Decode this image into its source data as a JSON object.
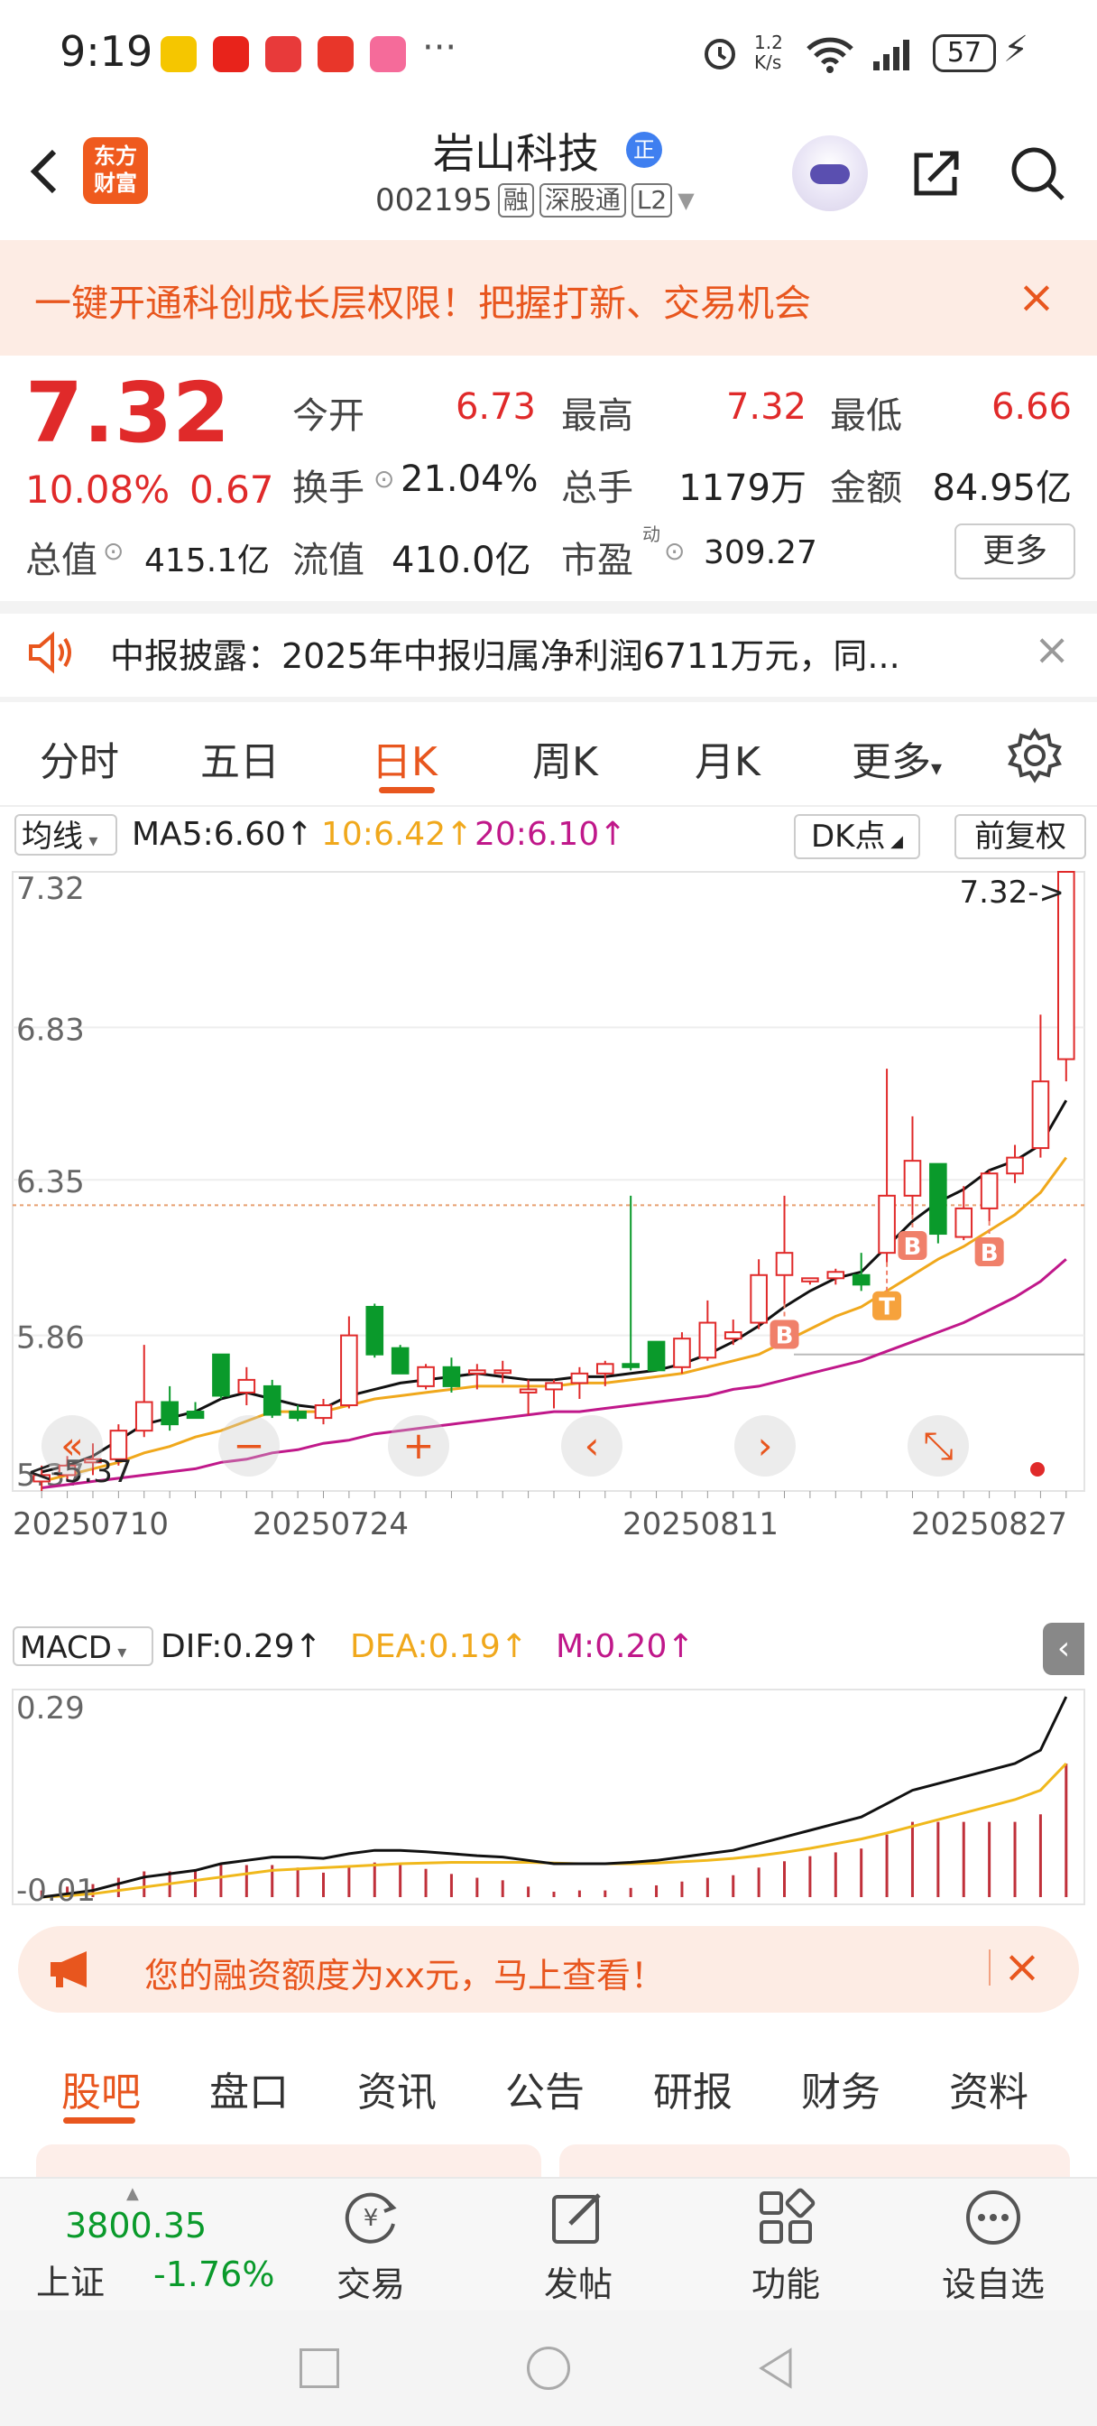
{
  "status_bar": {
    "time": "9:19",
    "dots": "···",
    "speed": "1.2\nK/s",
    "battery": "57"
  },
  "header": {
    "logo_line1": "东方",
    "logo_line2": "财富",
    "stock_name": "岩山科技",
    "name_badge": "正",
    "code": "002195",
    "tags": [
      "融",
      "深股通",
      "L2"
    ]
  },
  "banner": {
    "text": "一键开通科创成长层权限！把握打新、交易机会",
    "close": "×"
  },
  "quote": {
    "price": "7.32",
    "pct": "10.08%",
    "change": "0.67",
    "fields": [
      {
        "label": "今开",
        "value": "6.73",
        "color": "#e02a2a"
      },
      {
        "label": "最高",
        "value": "7.32",
        "color": "#e02a2a"
      },
      {
        "label": "最低",
        "value": "6.66",
        "color": "#e02a2a"
      },
      {
        "label": "换手",
        "value": "21.04%",
        "color": "#222"
      },
      {
        "label": "总手",
        "value": "1179万",
        "color": "#222"
      },
      {
        "label": "金额",
        "value": "84.95亿",
        "color": "#222"
      },
      {
        "label": "总值",
        "value": "415.1亿",
        "color": "#222"
      },
      {
        "label": "流值",
        "value": "410.0亿",
        "color": "#222"
      },
      {
        "label": "市盈",
        "value": "309.27",
        "color": "#222"
      }
    ],
    "pe_superscript": "动",
    "more": "更多"
  },
  "announcement": {
    "text": "中报披露：2025年中报归属净利润6711万元，同...",
    "close": "×"
  },
  "kline_tabs": [
    "分时",
    "五日",
    "日K",
    "周K",
    "月K",
    "更多"
  ],
  "active_tab": "日K",
  "ma_row": {
    "selector": "均线",
    "ma5": "MA5:6.60↑",
    "ma10": "10:6.42↑",
    "ma20": "20:6.10↑",
    "dk": "DK点",
    "fq": "前复权"
  },
  "chart_data": {
    "type": "candlestick",
    "y_ticks": [
      "7.32",
      "6.83",
      "6.35",
      "5.86",
      "5.37"
    ],
    "ylim": [
      5.37,
      7.32
    ],
    "x_ticks": [
      "20250710",
      "20250724",
      "20250811",
      "20250827"
    ],
    "last_price_label": "7.32->",
    "low_label": "<-5.37",
    "candles": [
      {
        "o": 5.4,
        "h": 5.45,
        "l": 5.37,
        "c": 5.42
      },
      {
        "o": 5.42,
        "h": 5.48,
        "l": 5.4,
        "c": 5.45
      },
      {
        "o": 5.46,
        "h": 5.52,
        "l": 5.42,
        "c": 5.47
      },
      {
        "o": 5.47,
        "h": 5.58,
        "l": 5.45,
        "c": 5.56
      },
      {
        "o": 5.56,
        "h": 5.83,
        "l": 5.54,
        "c": 5.65
      },
      {
        "o": 5.65,
        "h": 5.7,
        "l": 5.56,
        "c": 5.58
      },
      {
        "o": 5.62,
        "h": 5.65,
        "l": 5.72,
        "c": 5.6
      },
      {
        "o": 5.8,
        "h": 5.8,
        "l": 5.66,
        "c": 5.67
      },
      {
        "o": 5.68,
        "h": 5.76,
        "l": 5.64,
        "c": 5.72
      },
      {
        "o": 5.7,
        "h": 5.72,
        "l": 5.6,
        "c": 5.61
      },
      {
        "o": 5.62,
        "h": 5.64,
        "l": 5.59,
        "c": 5.6
      },
      {
        "o": 5.6,
        "h": 5.66,
        "l": 5.58,
        "c": 5.64
      },
      {
        "o": 5.64,
        "h": 5.92,
        "l": 5.63,
        "c": 5.86
      },
      {
        "o": 5.95,
        "h": 5.96,
        "l": 5.79,
        "c": 5.8
      },
      {
        "o": 5.82,
        "h": 5.83,
        "l": 5.74,
        "c": 5.74
      },
      {
        "o": 5.7,
        "h": 5.77,
        "l": 5.69,
        "c": 5.76
      },
      {
        "o": 5.76,
        "h": 5.79,
        "l": 5.68,
        "c": 5.7
      },
      {
        "o": 5.74,
        "h": 5.77,
        "l": 5.69,
        "c": 5.75
      },
      {
        "o": 5.75,
        "h": 5.78,
        "l": 5.71,
        "c": 5.75
      },
      {
        "o": 5.68,
        "h": 5.72,
        "l": 5.61,
        "c": 5.69
      },
      {
        "o": 5.69,
        "h": 5.72,
        "l": 5.63,
        "c": 5.71
      },
      {
        "o": 5.71,
        "h": 5.76,
        "l": 5.66,
        "c": 5.74
      },
      {
        "o": 5.74,
        "h": 5.78,
        "l": 5.7,
        "c": 5.77
      },
      {
        "o": 5.77,
        "h": 6.3,
        "l": 5.75,
        "c": 5.76
      },
      {
        "o": 5.84,
        "h": 5.84,
        "l": 5.75,
        "c": 5.75
      },
      {
        "o": 5.76,
        "h": 5.87,
        "l": 5.74,
        "c": 5.85
      },
      {
        "o": 5.79,
        "h": 5.97,
        "l": 5.78,
        "c": 5.9
      },
      {
        "o": 5.85,
        "h": 5.91,
        "l": 5.83,
        "c": 5.87
      },
      {
        "o": 5.9,
        "h": 6.1,
        "l": 5.88,
        "c": 6.05
      },
      {
        "o": 6.05,
        "h": 6.3,
        "l": 5.96,
        "c": 6.12
      },
      {
        "o": 6.03,
        "h": 6.04,
        "l": 6.02,
        "c": 6.04
      },
      {
        "o": 6.04,
        "h": 6.07,
        "l": 6.02,
        "c": 6.06
      },
      {
        "o": 6.05,
        "h": 6.12,
        "l": 6.0,
        "c": 6.02
      },
      {
        "o": 6.12,
        "h": 6.7,
        "l": 6.09,
        "c": 6.3
      },
      {
        "o": 6.3,
        "h": 6.55,
        "l": 6.24,
        "c": 6.41
      },
      {
        "o": 6.4,
        "h": 6.4,
        "l": 6.15,
        "c": 6.18
      },
      {
        "o": 6.17,
        "h": 6.33,
        "l": 6.16,
        "c": 6.26
      },
      {
        "o": 6.26,
        "h": 6.38,
        "l": 6.22,
        "c": 6.37
      },
      {
        "o": 6.37,
        "h": 6.46,
        "l": 6.34,
        "c": 6.42
      },
      {
        "o": 6.45,
        "h": 6.87,
        "l": 6.42,
        "c": 6.66
      },
      {
        "o": 6.73,
        "h": 7.32,
        "l": 6.66,
        "c": 7.32
      }
    ],
    "ma5": [
      5.43,
      5.45,
      5.48,
      5.53,
      5.58,
      5.6,
      5.62,
      5.66,
      5.68,
      5.66,
      5.64,
      5.63,
      5.67,
      5.69,
      5.71,
      5.72,
      5.73,
      5.74,
      5.73,
      5.72,
      5.72,
      5.73,
      5.73,
      5.74,
      5.75,
      5.77,
      5.8,
      5.84,
      5.89,
      5.95,
      6.0,
      6.04,
      6.06,
      6.14,
      6.22,
      6.28,
      6.32,
      6.38,
      6.41,
      6.46,
      6.6
    ],
    "ma10": [
      5.4,
      5.42,
      5.44,
      5.46,
      5.49,
      5.51,
      5.54,
      5.56,
      5.59,
      5.62,
      5.62,
      5.62,
      5.64,
      5.66,
      5.67,
      5.68,
      5.69,
      5.7,
      5.7,
      5.7,
      5.7,
      5.71,
      5.71,
      5.72,
      5.73,
      5.74,
      5.76,
      5.78,
      5.8,
      5.84,
      5.88,
      5.92,
      5.95,
      6.0,
      6.05,
      6.1,
      6.14,
      6.19,
      6.24,
      6.31,
      6.42
    ],
    "ma20": [
      5.38,
      5.39,
      5.4,
      5.41,
      5.42,
      5.43,
      5.44,
      5.46,
      5.47,
      5.49,
      5.5,
      5.52,
      5.53,
      5.55,
      5.56,
      5.57,
      5.58,
      5.59,
      5.6,
      5.61,
      5.62,
      5.62,
      5.63,
      5.64,
      5.65,
      5.66,
      5.67,
      5.69,
      5.7,
      5.72,
      5.74,
      5.76,
      5.78,
      5.81,
      5.84,
      5.87,
      5.9,
      5.94,
      5.98,
      6.03,
      6.1
    ],
    "markers": [
      {
        "label": "B",
        "index": 29,
        "type": "buy"
      },
      {
        "label": "T",
        "index": 33,
        "type": "t"
      },
      {
        "label": "B",
        "index": 34,
        "type": "buy"
      },
      {
        "label": "B",
        "index": 37,
        "type": "buy"
      }
    ],
    "macd": {
      "selector": "MACD",
      "dif_label": "DIF:0.29↑",
      "dea_label": "DEA:0.19↑",
      "m_label": "M:0.20↑",
      "y_ticks": [
        "0.29",
        "-0.01"
      ],
      "ylim": [
        -0.01,
        0.29
      ],
      "dif": [
        -0.01,
        -0.005,
        0.0,
        0.01,
        0.02,
        0.025,
        0.03,
        0.04,
        0.045,
        0.05,
        0.05,
        0.048,
        0.055,
        0.06,
        0.06,
        0.058,
        0.055,
        0.052,
        0.05,
        0.045,
        0.04,
        0.04,
        0.04,
        0.042,
        0.045,
        0.05,
        0.055,
        0.06,
        0.07,
        0.08,
        0.09,
        0.1,
        0.11,
        0.13,
        0.15,
        0.16,
        0.17,
        0.18,
        0.19,
        0.21,
        0.29
      ],
      "dea": [
        -0.01,
        -0.008,
        -0.005,
        0.0,
        0.005,
        0.01,
        0.015,
        0.02,
        0.025,
        0.03,
        0.032,
        0.034,
        0.036,
        0.038,
        0.04,
        0.041,
        0.042,
        0.042,
        0.042,
        0.042,
        0.041,
        0.04,
        0.04,
        0.04,
        0.041,
        0.043,
        0.045,
        0.048,
        0.052,
        0.057,
        0.063,
        0.07,
        0.077,
        0.086,
        0.096,
        0.106,
        0.116,
        0.126,
        0.136,
        0.15,
        0.19
      ],
      "m": [
        0.0,
        0.006,
        0.01,
        0.02,
        0.03,
        0.03,
        0.03,
        0.04,
        0.04,
        0.04,
        0.036,
        0.028,
        0.038,
        0.044,
        0.04,
        0.034,
        0.026,
        0.02,
        0.016,
        0.006,
        -0.002,
        0.0,
        0.0,
        0.004,
        0.008,
        0.014,
        0.02,
        0.024,
        0.036,
        0.046,
        0.054,
        0.06,
        0.066,
        0.088,
        0.108,
        0.108,
        0.108,
        0.108,
        0.108,
        0.12,
        0.2
      ]
    }
  },
  "margin_banner": {
    "text": "您的融资额度为xx元，马上查看！",
    "close": "×"
  },
  "bottom_tabs": [
    "股吧",
    "盘口",
    "资讯",
    "公告",
    "研报",
    "财务",
    "资料"
  ],
  "bottom_nav": {
    "index_value": "3800.35",
    "index_name": "上证",
    "index_change": "-1.76%",
    "items": [
      {
        "label": "交易",
        "icon": "trade-icon"
      },
      {
        "label": "发帖",
        "icon": "post-icon"
      },
      {
        "label": "功能",
        "icon": "grid-icon"
      },
      {
        "label": "设自选",
        "icon": "more-dots-icon"
      }
    ]
  }
}
